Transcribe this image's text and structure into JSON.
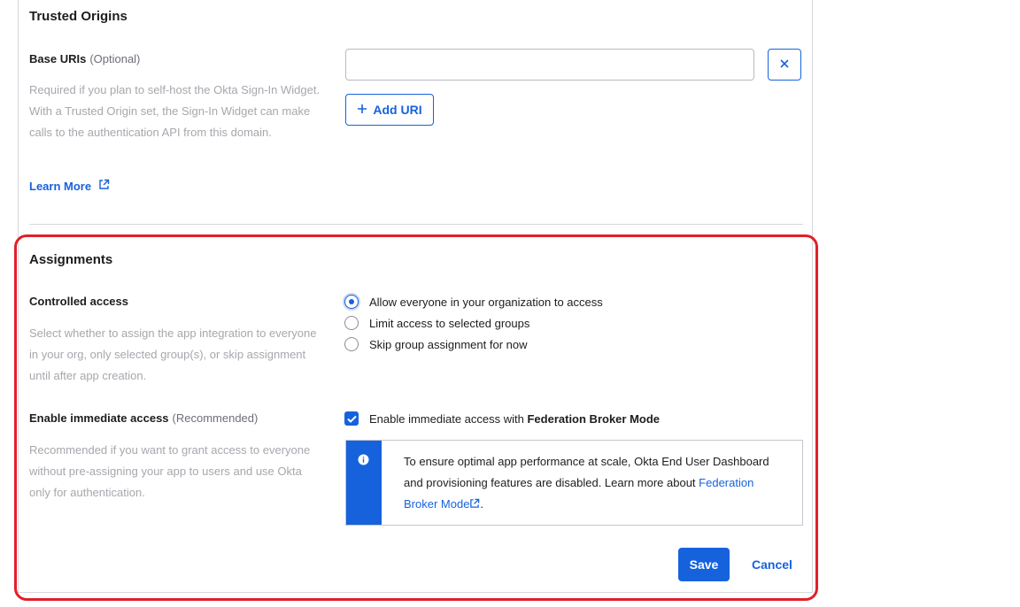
{
  "trusted_origins": {
    "title": "Trusted Origins",
    "base_uris_label": "Base URIs",
    "base_uris_optional": "(Optional)",
    "help_text": "Required if you plan to self-host the Okta Sign-In Widget. With a Trusted Origin set, the Sign-In Widget can make calls to the authentication API from this domain.",
    "learn_more": "Learn More",
    "uri_value": "",
    "add_uri_label": "Add URI"
  },
  "assignments": {
    "title": "Assignments",
    "controlled_access_label": "Controlled access",
    "controlled_access_help": "Select whether to assign the app integration to everyone in your org, only selected group(s), or skip assignment until after app creation.",
    "options": [
      {
        "label": "Allow everyone in your organization to access",
        "checked": true
      },
      {
        "label": "Limit access to selected groups",
        "checked": false
      },
      {
        "label": "Skip group assignment for now",
        "checked": false
      }
    ],
    "immediate_access_label": "Enable immediate access",
    "immediate_access_recommended": "(Recommended)",
    "immediate_access_help": "Recommended if you want to grant access to everyone without pre-assigning your app to users and use Okta only for authentication.",
    "checkbox_label_prefix": "Enable immediate access with ",
    "checkbox_label_bold": "Federation Broker Mode",
    "checkbox_checked": true,
    "callout_text": "To ensure optimal app performance at scale, Okta End User Dashboard and provisioning features are disabled. Learn more about ",
    "callout_link": "Federation Broker Mode",
    "callout_end": "."
  },
  "actions": {
    "save_label": "Save",
    "cancel_label": "Cancel"
  },
  "colors": {
    "accent": "#1662dd",
    "highlight": "#e0202a"
  }
}
